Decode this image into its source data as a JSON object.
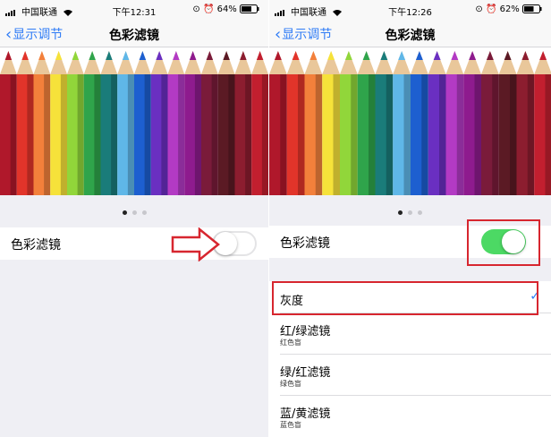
{
  "colors": {
    "accent": "#2f7cf6",
    "toggle_on": "#4cd964",
    "highlight": "#d7262f"
  },
  "pencil_colors": [
    "#b0182b",
    "#e2342a",
    "#f3803b",
    "#f6e23a",
    "#91d63a",
    "#2fa44b",
    "#1a7c7a",
    "#5fb7e8",
    "#1d5fd0",
    "#6a2fc1",
    "#b33ac4",
    "#8e1b8e",
    "#7a1b3a",
    "#5b1a24",
    "#8c1d2f",
    "#c21f2f"
  ],
  "left": {
    "status": {
      "carrier": "中国联通",
      "time": "下午12:31",
      "battery": "64%"
    },
    "nav": {
      "back_label": "显示调节",
      "title": "色彩滤镜"
    },
    "toggle_row": {
      "label": "色彩滤镜",
      "state": "off"
    }
  },
  "right": {
    "status": {
      "carrier": "中国联通",
      "time": "下午12:26",
      "battery": "62%"
    },
    "nav": {
      "back_label": "显示调节",
      "title": "色彩滤镜"
    },
    "toggle_row": {
      "label": "色彩滤镜",
      "state": "on"
    },
    "options": [
      {
        "title": "灰度",
        "subtitle": "",
        "checked": true
      },
      {
        "title": "红/绿滤镜",
        "subtitle": "红色盲",
        "checked": false
      },
      {
        "title": "绿/红滤镜",
        "subtitle": "绿色盲",
        "checked": false
      },
      {
        "title": "蓝/黄滤镜",
        "subtitle": "蓝色盲",
        "checked": false
      }
    ],
    "check_icon": "checkmark-icon"
  }
}
